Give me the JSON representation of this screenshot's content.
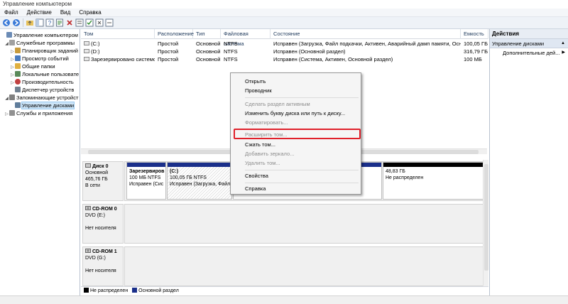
{
  "window": {
    "title": "Управление компьютером"
  },
  "menu": [
    {
      "label": "Файл"
    },
    {
      "label": "Действие"
    },
    {
      "label": "Вид"
    },
    {
      "label": "Справка"
    }
  ],
  "tree": {
    "items": [
      {
        "label": "Управление компьютером (л",
        "icon": "computer-icon",
        "exp": "",
        "color": "#6b8bb5"
      },
      {
        "label": "Служебные программы",
        "icon": "tools-icon",
        "exp": "◢",
        "color": "#a0a0a0"
      },
      {
        "label": "Планировщик заданий",
        "icon": "scheduler-icon",
        "exp": "▷",
        "color": "#c89b3c"
      },
      {
        "label": "Просмотр событий",
        "icon": "event-viewer-icon",
        "exp": "▷",
        "color": "#4a7cc0"
      },
      {
        "label": "Общие папки",
        "icon": "shared-folder-icon",
        "exp": "▷",
        "color": "#e0b040"
      },
      {
        "label": "Локальные пользовате",
        "icon": "users-icon",
        "exp": "▷",
        "color": "#5a8a5a"
      },
      {
        "label": "Производительность",
        "icon": "performance-icon",
        "exp": "▷",
        "color": "#c04040"
      },
      {
        "label": "Диспетчер устройств",
        "icon": "device-manager-icon",
        "exp": "",
        "color": "#708090"
      },
      {
        "label": "Запоминающие устройст",
        "icon": "storage-icon",
        "exp": "◢",
        "color": "#808080"
      },
      {
        "label": "Управление дисками",
        "icon": "disk-management-icon",
        "exp": "",
        "color": "#607d9b"
      },
      {
        "label": "Службы и приложения",
        "icon": "services-icon",
        "exp": "▷",
        "color": "#909090"
      }
    ]
  },
  "volumes": {
    "columns": [
      "Том",
      "Расположение",
      "Тип",
      "Файловая система",
      "Состояние",
      "Емкость"
    ],
    "rows": [
      {
        "name": "(C:)",
        "layout": "Простой",
        "type": "Основной",
        "fs": "NTFS",
        "status": "Исправен (Загрузка, Файл подкачки, Активен, Аварийный дамп памяти, Осно",
        "capacity": "100,05 ГБ"
      },
      {
        "name": "(D:)",
        "layout": "Простой",
        "type": "Основной",
        "fs": "NTFS",
        "status": "Исправен (Основной раздел)",
        "capacity": "316,79 ГБ"
      },
      {
        "name": "Зарезервировано системой",
        "layout": "Простой",
        "type": "Основной",
        "fs": "NTFS",
        "status": "Исправен (Система, Активен, Основной раздел)",
        "capacity": "100 МБ"
      }
    ]
  },
  "disks": {
    "disk0": {
      "title": "Диск 0",
      "kind": "Основной",
      "size": "465,76 ГБ",
      "state": "В сети",
      "partitions": [
        {
          "name": "Зарезервиров",
          "size": "100 МБ NTFS",
          "status": "Исправен (Сис"
        },
        {
          "name": "(C:)",
          "size": "100,05 ГБ NTFS",
          "status": "Исправен (Загрузка, Файл"
        },
        {
          "name": "",
          "size": "",
          "status": ""
        },
        {
          "name": "48,83 ГБ",
          "size": "Не распределен",
          "status": ""
        }
      ]
    },
    "cdrom0": {
      "title": "CD-ROM 0",
      "kind": "DVD (E:)",
      "state": "Нет носителя"
    },
    "cdrom1": {
      "title": "CD-ROM 1",
      "kind": "DVD (G:)",
      "state": "Нет носителя"
    }
  },
  "legend": {
    "unallocated": "Не распределен",
    "primary": "Основной раздел",
    "unallocated_color": "#000000",
    "primary_color": "#1a2f8a"
  },
  "actions": {
    "header": "Действия",
    "section": "Управление дисками",
    "more": "Дополнительные дей..."
  },
  "context_menu": {
    "items": [
      {
        "label": "Открыть",
        "disabled": false
      },
      {
        "label": "Проводник",
        "disabled": false
      },
      {
        "label": "Сделать раздел активным",
        "disabled": true
      },
      {
        "label": "Изменить букву диска или путь к диску...",
        "disabled": false
      },
      {
        "label": "Форматировать...",
        "disabled": true
      },
      {
        "label": "Расширить том...",
        "disabled": true
      },
      {
        "label": "Сжать том...",
        "disabled": false
      },
      {
        "label": "Добавить зеркало...",
        "disabled": true
      },
      {
        "label": "Удалить том...",
        "disabled": true
      },
      {
        "label": "Свойства",
        "disabled": false
      },
      {
        "label": "Справка",
        "disabled": false
      }
    ],
    "highlight_color": "#e0202a"
  }
}
